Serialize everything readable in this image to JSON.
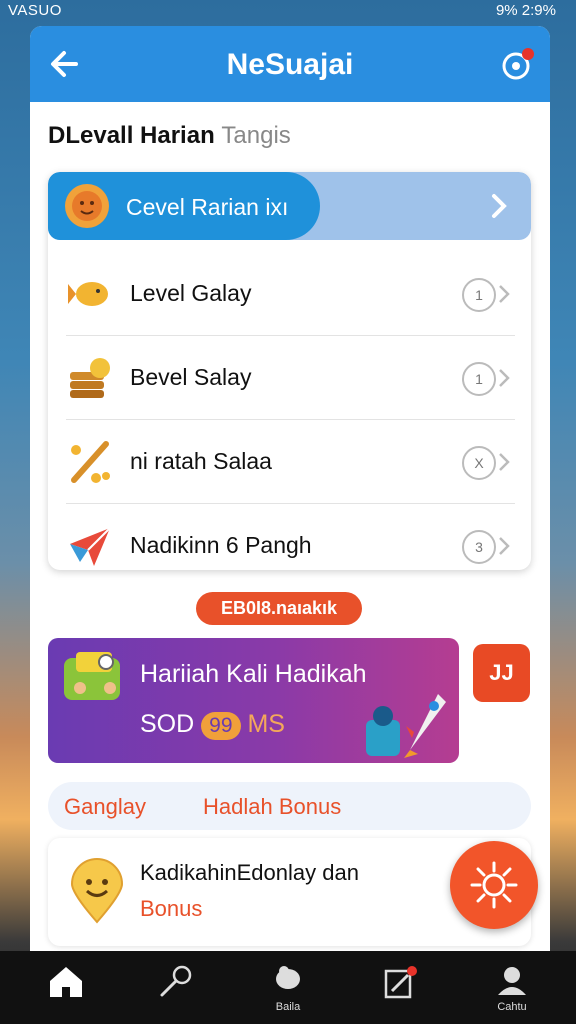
{
  "status_bar": {
    "left": "VASUO",
    "right": "9% 2:9%"
  },
  "app_bar": {
    "title": "NeSuajai",
    "back_icon": "arrow-left-icon",
    "action_icon": "gear-icon"
  },
  "heading": {
    "title": "DLevall Harian",
    "subtitle": "Tangis"
  },
  "highlight_item": {
    "label": "Cevel Rarian ixı"
  },
  "items": [
    {
      "label": "Level Galay",
      "badge": "1"
    },
    {
      "label": "Bevel Salay",
      "badge": "1"
    },
    {
      "label": "ni ratah Salaa",
      "badge": "X"
    },
    {
      "label": "Nadikinn 6 Pangh",
      "badge": "3"
    }
  ],
  "pill": {
    "label": "EB0I8.naıakık"
  },
  "promo": {
    "title": "Hariiah Kali Hadikah",
    "prefix": "SOD",
    "badge": "99",
    "suffix": "MS"
  },
  "side_button": {
    "label": "JJ"
  },
  "tabs": {
    "left": "Ganglay",
    "right": "Hadlah Bonus"
  },
  "bonus_card": {
    "line1": "KadikahinEdonlay dan",
    "line2": "Bonus"
  },
  "bottom_nav": [
    {
      "icon": "home-icon",
      "label": ""
    },
    {
      "icon": "microphone-icon",
      "label": ""
    },
    {
      "icon": "coins-icon",
      "label": "Baila"
    },
    {
      "icon": "edit-icon",
      "label": ""
    },
    {
      "icon": "profile-icon",
      "label": "Cahtu"
    }
  ],
  "colors": {
    "primary": "#2a8ee0",
    "accent": "#e8512a",
    "promo_start": "#6a3bb2",
    "promo_end": "#b53d91"
  }
}
